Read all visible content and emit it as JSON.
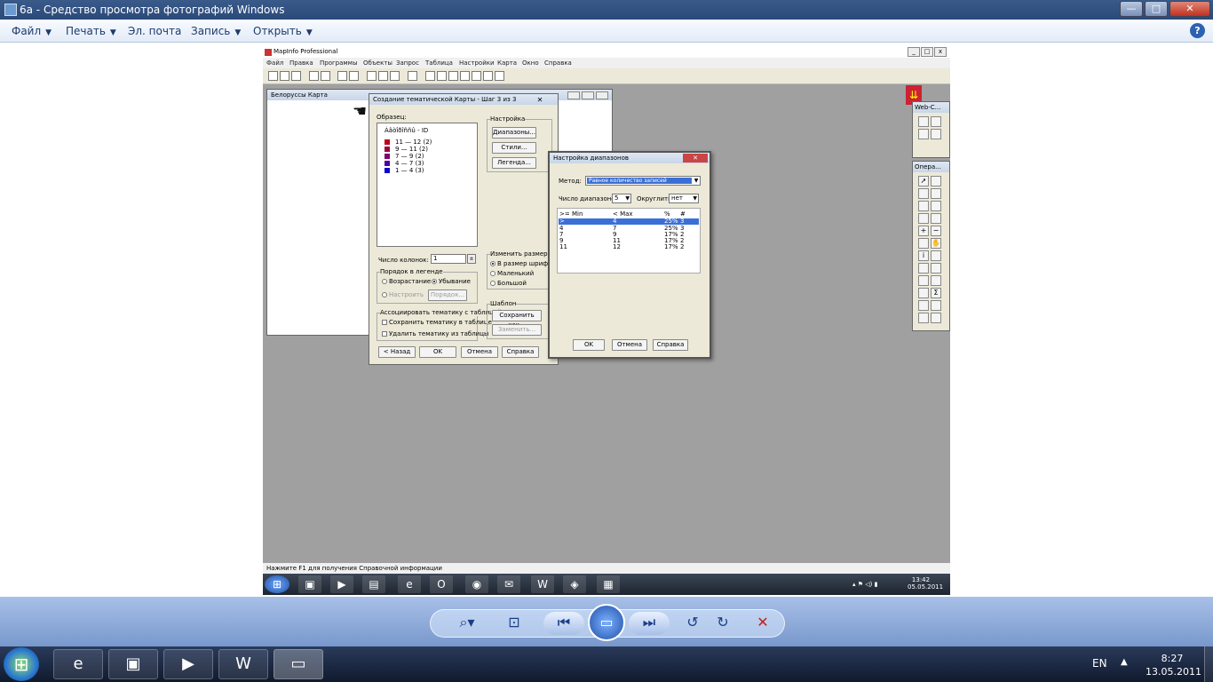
{
  "viewer": {
    "title": "6а - Средство просмотра фотографий Windows",
    "menu": {
      "file": "Файл",
      "print": "Печать",
      "email": "Эл. почта",
      "burn": "Запись",
      "open": "Открыть"
    },
    "help": "?"
  },
  "mapinfo": {
    "title": "MapInfo Professional",
    "menu": [
      "Файл",
      "Правка",
      "Программы",
      "Объекты",
      "Запрос",
      "Таблица",
      "Настройки",
      "Карта",
      "Окно",
      "Справка"
    ],
    "map_window_title": "Белоруссы Карта",
    "status": "Нажмите F1 для получения Справочной информации",
    "clock": {
      "time": "13:42",
      "date": "05.05.2011"
    }
  },
  "wizard": {
    "title": "Создание тематической Карты - Шаг 3 из 3",
    "sample_label": "Образец:",
    "legend_heading": "Àâòîðîññû - ID",
    "legend": [
      {
        "text": "11 — 12  (2)",
        "color": "#c00018"
      },
      {
        "text": "9 — 11  (2)",
        "color": "#a00040"
      },
      {
        "text": "7 — 9  (2)",
        "color": "#800070"
      },
      {
        "text": "4 — 7  (3)",
        "color": "#5000a0"
      },
      {
        "text": "1 — 4  (3)",
        "color": "#1000d0"
      }
    ],
    "settings_label": "Настройка",
    "ranges_btn": "Диапазоны...",
    "styles_btn": "Стили...",
    "legend_btn": "Легенда...",
    "columns_label": "Число колонок:",
    "columns_value": "1",
    "order_label": "Порядок в легенде",
    "asc": "Возрастание",
    "desc": "Убывание",
    "custom": "Настроить",
    "order_btn": "Порядок...",
    "resize_label": "Изменить размер",
    "by_font": "В размер шрифта",
    "smaller": "Маленький",
    "larger": "Большой",
    "assoc_label": "Ассоциировать тематику с таблицей",
    "save_to_table": "Сохранить тематику в таблице",
    "remove_from_table": "Удалить тематику из таблицы",
    "template_label": "Шаблон",
    "save_as": "Сохранить как...",
    "replace": "Заменить...",
    "back": "< Назад",
    "ok": "OK",
    "cancel": "Отмена",
    "help": "Справка"
  },
  "ranges": {
    "title": "Настройка диапазонов",
    "method_label": "Метод:",
    "method_value": "Равное количество записей",
    "count_label": "Число диапазонов",
    "count_value": "5",
    "round_label": "Округлить:",
    "round_value": "нет",
    "headers": [
      ">= Min",
      "< Max",
      "%",
      "#"
    ],
    "rows": [
      [
        ">",
        "4",
        "25%",
        "3"
      ],
      [
        "4",
        "7",
        "25%",
        "3"
      ],
      [
        "7",
        "9",
        "17%",
        "2"
      ],
      [
        "9",
        "11",
        "17%",
        "2"
      ],
      [
        "11",
        "12",
        "17%",
        "2"
      ]
    ],
    "ok": "OK",
    "cancel": "Отмена",
    "help": "Справка"
  },
  "palettes": {
    "web": "Web-С...",
    "ops": "Опера..."
  },
  "taskbar": {
    "lang": "EN",
    "time": "8:27",
    "date": "13.05.2011"
  }
}
